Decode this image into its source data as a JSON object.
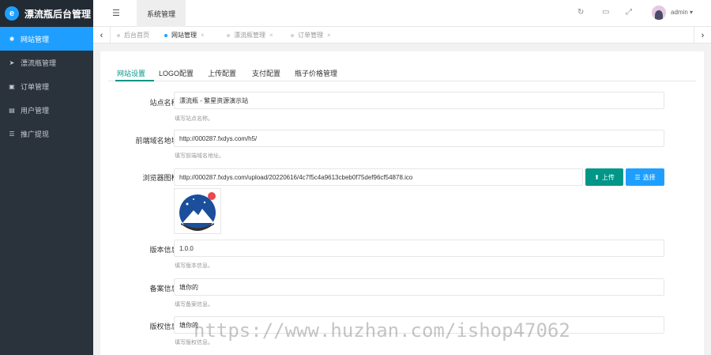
{
  "brand": {
    "title": "漂流瓶后台管理",
    "logo_letter": "e"
  },
  "sidebar": {
    "items": [
      {
        "label": "网站管理",
        "icon": "gear-icon",
        "glyph": "✱",
        "active": true
      },
      {
        "label": "漂流瓶管理",
        "icon": "paper-plane-icon",
        "glyph": "➤",
        "active": false
      },
      {
        "label": "订单管理",
        "icon": "calendar-icon",
        "glyph": "▣",
        "active": false
      },
      {
        "label": "用户管理",
        "icon": "user-card-icon",
        "glyph": "▤",
        "active": false
      },
      {
        "label": "推广提现",
        "icon": "list-icon",
        "glyph": "☰",
        "active": false
      }
    ]
  },
  "header": {
    "menu_toggle_icon": "hamburger-icon",
    "section_tab": "系统管理",
    "icons": [
      "refresh-icon",
      "trash-icon",
      "fullscreen-icon"
    ],
    "user": "admin"
  },
  "tabs": [
    {
      "label": "后台首页",
      "closable": false,
      "active": false
    },
    {
      "label": "网站管理",
      "closable": true,
      "active": true
    },
    {
      "label": "漂流瓶管理",
      "closable": true,
      "active": false
    },
    {
      "label": "订单管理",
      "closable": true,
      "active": false
    }
  ],
  "subtabs": [
    "网站设置",
    "LOGO配置",
    "上传配置",
    "支付配置",
    "瓶子价格管理"
  ],
  "form": {
    "site_name": {
      "label": "站点名称",
      "value": "漂流瓶 - 繁星资源演示站",
      "hint": "填写站点名称。"
    },
    "domain": {
      "label": "前端域名地址",
      "value": "http://000287.fxdys.com/h5/",
      "hint": "填写前端域名地址。"
    },
    "favicon": {
      "label": "浏览器图标",
      "value": "http://000287.fxdys.com/upload/20220616/4c7f5c4a9613cbeb0f75def96cf54878.ico",
      "upload_label": "上传",
      "select_label": "选择"
    },
    "version": {
      "label": "版本信息",
      "value": "1.0.0",
      "hint": "填写版本信息。"
    },
    "icp": {
      "label": "备案信息",
      "value": "填你的",
      "hint": "填写备案信息。"
    },
    "copyright": {
      "label": "版权信息",
      "value": "填你的",
      "hint": "填写版权信息。"
    },
    "required_mark": "*"
  },
  "watermark": "https://www.huzhan.com/ishop47062",
  "colors": {
    "sidebar": "#2a323c",
    "accent_blue": "#1e9fff",
    "accent_green": "#009688",
    "required": "#ff5722"
  }
}
